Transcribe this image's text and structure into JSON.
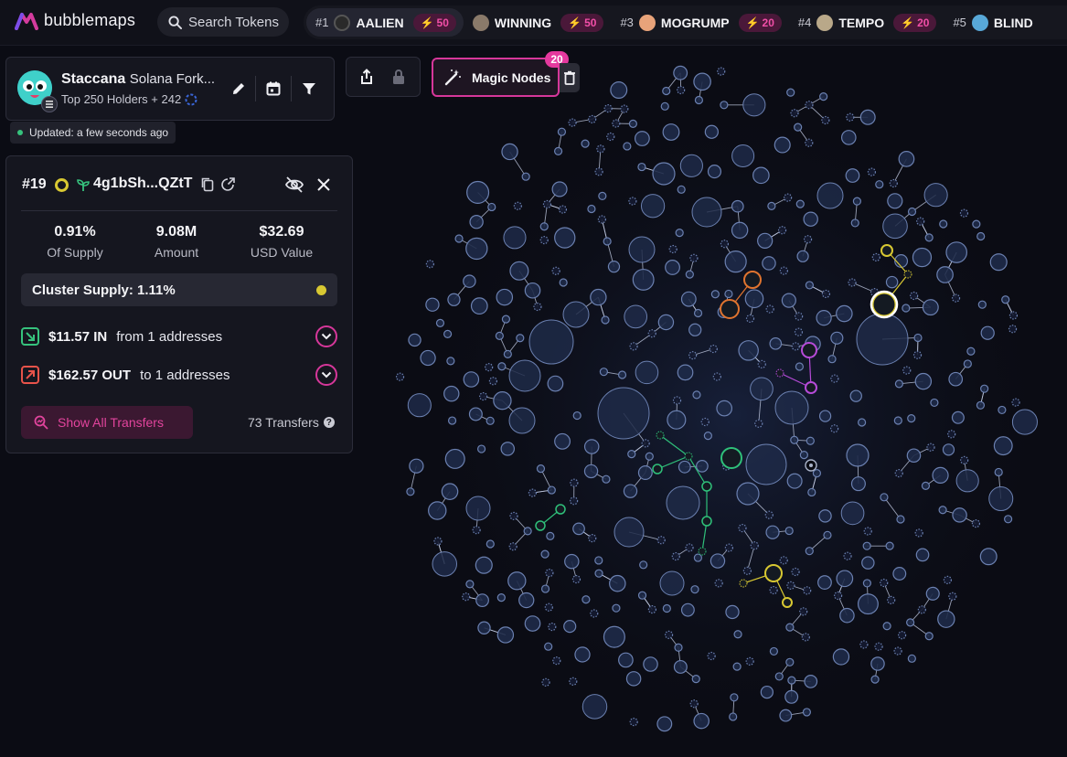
{
  "app": {
    "name": "bubblemaps"
  },
  "search": {
    "placeholder": "Search Tokens"
  },
  "trending": [
    {
      "rank": "#1",
      "name": "AALIEN",
      "boost": "50",
      "avatar_color": "#2a2a2a"
    },
    {
      "rank": "",
      "name": "WINNING",
      "boost": "50",
      "avatar_color": "#8a7a6a"
    },
    {
      "rank": "#3",
      "name": "MOGRUMP",
      "boost": "20",
      "avatar_color": "#e8a37a"
    },
    {
      "rank": "#4",
      "name": "TEMPO",
      "boost": "20",
      "avatar_color": "#b9a889"
    },
    {
      "rank": "#5",
      "name": "BLIND",
      "boost": "",
      "avatar_color": "#58a8d8"
    }
  ],
  "token": {
    "name": "Staccana",
    "chain": "Solana Fork...",
    "holders": "Top 250 Holders + 242"
  },
  "updated": "Updated: a few seconds ago",
  "magic_nodes": {
    "label": "Magic Nodes",
    "count": "20"
  },
  "holder": {
    "rank": "#19",
    "address": "4g1bSh...QZtT",
    "stats": [
      {
        "value": "0.91%",
        "label": "Of Supply"
      },
      {
        "value": "9.08M",
        "label": "Amount"
      },
      {
        "value": "$32.69",
        "label": "USD Value"
      }
    ],
    "cluster_supply": "Cluster Supply: 1.11%",
    "flow_in": {
      "amount": "$11.57 IN",
      "detail": "from 1 addresses"
    },
    "flow_out": {
      "amount": "$162.57 OUT",
      "detail": "to 1 addresses"
    },
    "show_transfers": "Show All Transfers",
    "transfers_count": "73 Transfers"
  },
  "colors": {
    "accent": "#e2449d",
    "selected_cluster": "#d8c832",
    "bubble_fill": "#1e2a48",
    "bubble_stroke": "#6b80b0",
    "cluster_orange": "#e0742f",
    "cluster_purple": "#b64bd8",
    "cluster_green": "#2fc07a"
  }
}
